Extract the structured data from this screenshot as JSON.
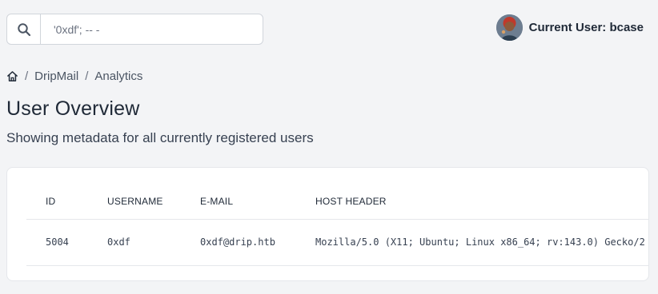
{
  "search": {
    "value": "'0xdf'; -- -"
  },
  "user": {
    "label": "Current User: bcase"
  },
  "breadcrumb": {
    "items": [
      "DripMail",
      "Analytics"
    ],
    "separator": "/"
  },
  "page": {
    "title": "User Overview",
    "subtitle": "Showing metadata for all currently registered users"
  },
  "table": {
    "headers": [
      "ID",
      "USERNAME",
      "E-MAIL",
      "HOST HEADER"
    ],
    "rows": [
      [
        "5004",
        "0xdf",
        "0xdf@drip.htb",
        "Mozilla/5.0 (X11; Ubuntu; Linux x86_64; rv:143.0) Gecko/2"
      ]
    ]
  }
}
